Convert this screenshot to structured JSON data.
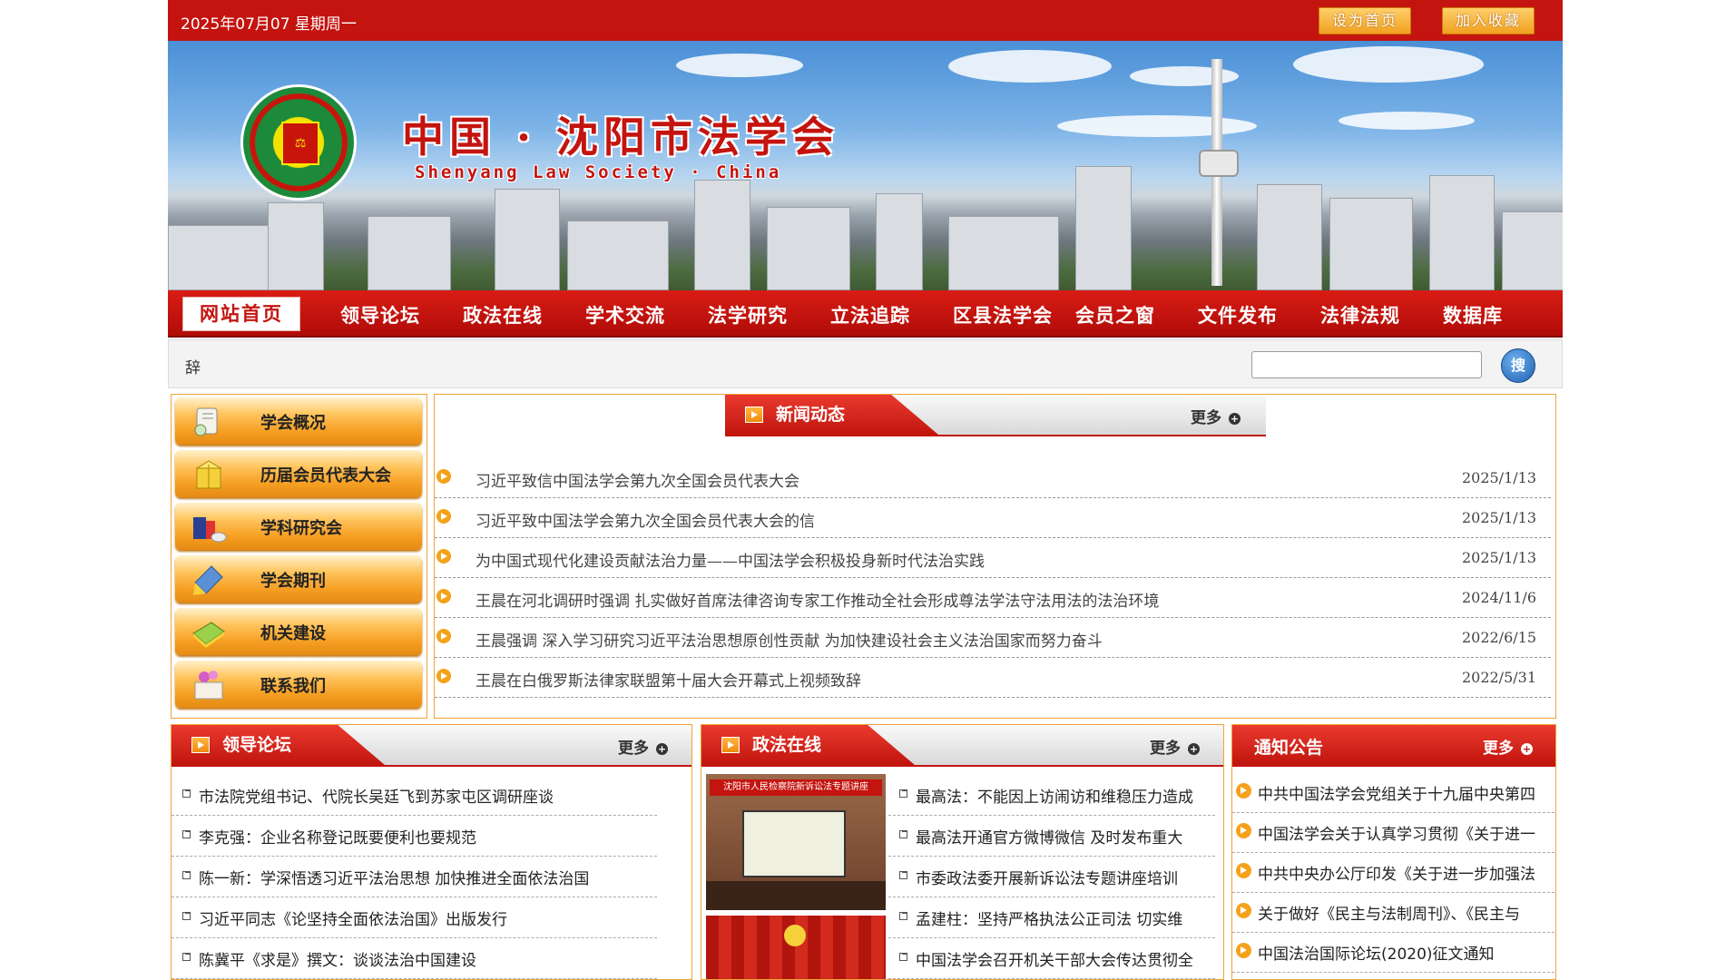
{
  "topbar": {
    "date": "2025年07月07 星期周一",
    "set_home": "设为首页",
    "bookmark": "加入收藏"
  },
  "banner": {
    "title_cn": "中国 · 沈阳市法学会",
    "title_en": "Shenyang Law Society · China"
  },
  "nav": {
    "home": "网站首页",
    "items": [
      "领导论坛",
      "政法在线",
      "学术交流",
      "法学研究",
      "立法追踪",
      "区县法学会",
      "会员之窗",
      "文件发布",
      "法律法规",
      "数据库"
    ]
  },
  "search": {
    "label": "辞",
    "button": "搜"
  },
  "left_menu": {
    "items": [
      {
        "label": "学会概况",
        "icon": "scroll-icon"
      },
      {
        "label": "历届会员代表大会",
        "icon": "gift-box-icon"
      },
      {
        "label": "学科研究会",
        "icon": "books-icon"
      },
      {
        "label": "学会期刊",
        "icon": "pencil-icon"
      },
      {
        "label": "机关建设",
        "icon": "notebook-icon"
      },
      {
        "label": "联系我们",
        "icon": "flower-letter-icon"
      }
    ]
  },
  "news": {
    "title": "新闻动态",
    "more": "更多",
    "rows": [
      {
        "title": "习近平致信中国法学会第九次全国会员代表大会",
        "date": "2025/1/13"
      },
      {
        "title": "习近平致中国法学会第九次全国会员代表大会的信",
        "date": "2025/1/13"
      },
      {
        "title": "为中国式现代化建设贡献法治力量——中国法学会积极投身新时代法治实践",
        "date": "2025/1/13"
      },
      {
        "title": "王晨在河北调研时强调 扎实做好首席法律咨询专家工作推动全社会形成尊法学法守法用法的法治环境",
        "date": "2024/11/6"
      },
      {
        "title": "王晨强调 深入学习研究习近平法治思想原创性贡献 为加快建设社会主义法治国家而努力奋斗",
        "date": "2022/6/15"
      },
      {
        "title": "王晨在白俄罗斯法律家联盟第十届大会开幕式上视频致辞",
        "date": "2022/5/31"
      }
    ]
  },
  "leaders": {
    "title": "领导论坛",
    "more": "更多",
    "items": [
      "市法院党组书记、代院长吴廷飞到苏家屯区调研座谈",
      "李克强：企业名称登记既要便利也要规范",
      "陈一新：学深悟透习近平法治思想 加快推进全面依法治国",
      "习近平同志《论坚持全面依法治国》出版发行",
      "陈冀平《求是》撰文：谈谈法治中国建设"
    ]
  },
  "politics": {
    "title": "政法在线",
    "more": "更多",
    "photo_banner": "沈阳市人民检察院新诉讼法专题讲座",
    "items": [
      "最高法：不能因上访闹访和维稳压力造成",
      "最高法开通官方微博微信 及时发布重大",
      "市委政法委开展新诉讼法专题讲座培训",
      "孟建柱：坚持严格执法公正司法 切实维",
      "中国法学会召开机关干部大会传达贯彻全"
    ]
  },
  "notices": {
    "title": "通知公告",
    "more": "更多",
    "items": [
      "中共中国法学会党组关于十九届中央第四",
      "中国法学会关于认真学习贯彻《关于进一",
      "中共中央办公厅印发《关于进一步加强法",
      "关于做好《民主与法制周刊》、《民主与",
      "中国法治国际论坛(2020)征文通知"
    ]
  },
  "colors": {
    "brand_red": "#c4140f",
    "accent_orange": "#f5a21a",
    "border_orange": "#f0a33a"
  }
}
